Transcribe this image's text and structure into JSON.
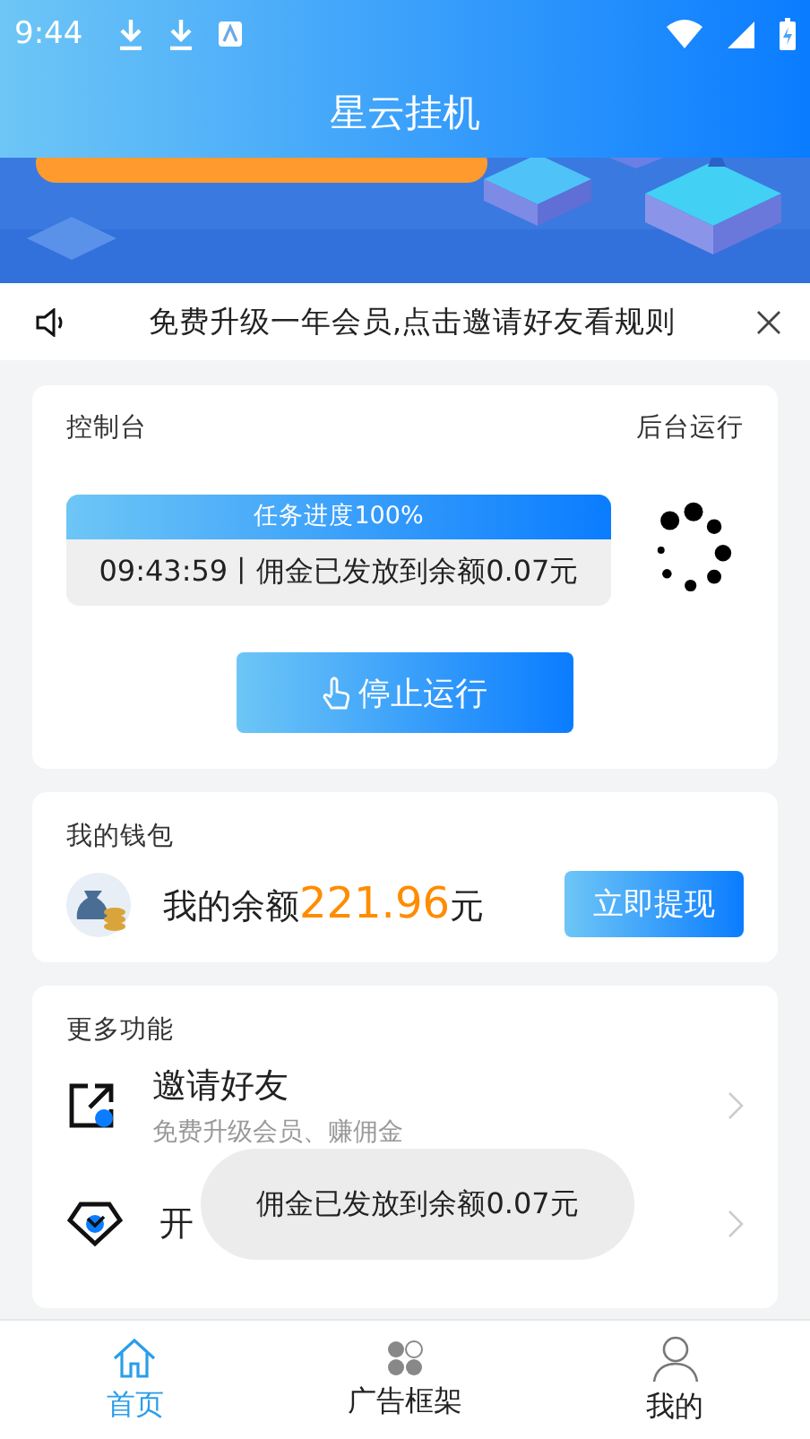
{
  "status_bar": {
    "time": "9:44"
  },
  "header": {
    "title": "星云挂机"
  },
  "notice": {
    "text": "免费升级一年会员,点击邀请好友看规则"
  },
  "console": {
    "title": "控制台",
    "mode": "后台运行",
    "progress": {
      "label": "任务进度100%",
      "level": 1
    },
    "log": "09:43:59丨佣金已发放到余额0.07元",
    "button": "停止运行"
  },
  "wallet": {
    "title": "我的钱包",
    "balance_label": "我的余额",
    "balance": "221.96",
    "unit": "元",
    "button": "立即提现"
  },
  "more": {
    "title": "更多功能",
    "items": [
      {
        "kind": "invite",
        "title": "邀请好友",
        "subtitle": "免费升级会员、赚佣金"
      },
      {
        "kind": "vip",
        "title": "开"
      }
    ]
  },
  "toast": {
    "text": "佣金已发放到余额0.07元"
  },
  "tabs": [
    {
      "kind": "home",
      "label": "首页",
      "selected": true
    },
    {
      "kind": "ads",
      "label": "广告框架",
      "selected": false
    },
    {
      "kind": "me",
      "label": "我的",
      "selected": false
    }
  ]
}
